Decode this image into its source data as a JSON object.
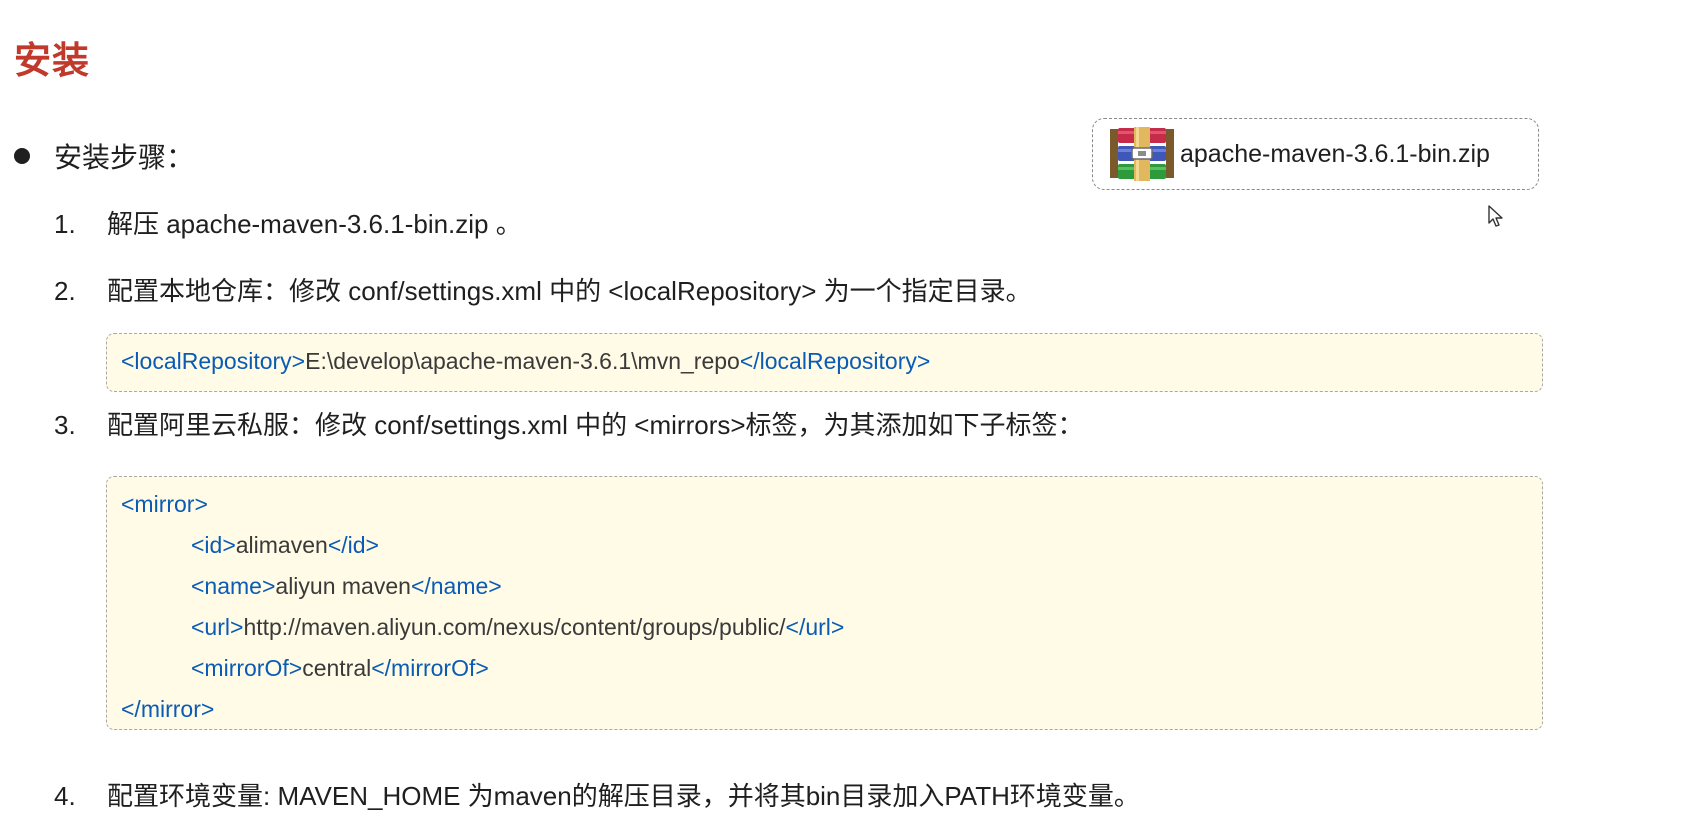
{
  "section_title": "安装",
  "bullet": {
    "text": "安装步骤："
  },
  "file": {
    "name": "apache-maven-3.6.1-bin.zip",
    "icon": "winrar-archive-icon"
  },
  "steps": [
    {
      "num": "1.",
      "text": "解压 apache-maven-3.6.1-bin.zip 。"
    },
    {
      "num": "2.",
      "text": "配置本地仓库：修改 conf/settings.xml 中的 <localRepository> 为一个指定目录。"
    },
    {
      "num": "3.",
      "text": "配置阿里云私服：修改 conf/settings.xml 中的 <mirrors>标签，为其添加如下子标签："
    },
    {
      "num": "4.",
      "text": "配置环境变量: MAVEN_HOME 为maven的解压目录，并将其bin目录加入PATH环境变量。"
    }
  ],
  "code_local_repo": {
    "open_tag": "<localRepository>",
    "value": "E:\\develop\\apache-maven-3.6.1\\mvn_repo",
    "close_tag": "</localRepository>"
  },
  "code_mirror": {
    "open": "<mirror>",
    "id_open": "<id>",
    "id_value": "alimaven",
    "id_close": "</id>",
    "name_open": "<name>",
    "name_value": "aliyun maven",
    "name_close": "</name>",
    "url_open": "<url>",
    "url_value": "http://maven.aliyun.com/nexus/content/groups/public/",
    "url_close": "</url>",
    "mirrorof_open": "<mirrorOf>",
    "mirrorof_value": "central",
    "mirrorof_close": "</mirrorOf>",
    "close": "</mirror>"
  },
  "colors": {
    "title": "#c0392b",
    "tag": "#0a5bb5",
    "code_bg": "#fffbe6"
  }
}
